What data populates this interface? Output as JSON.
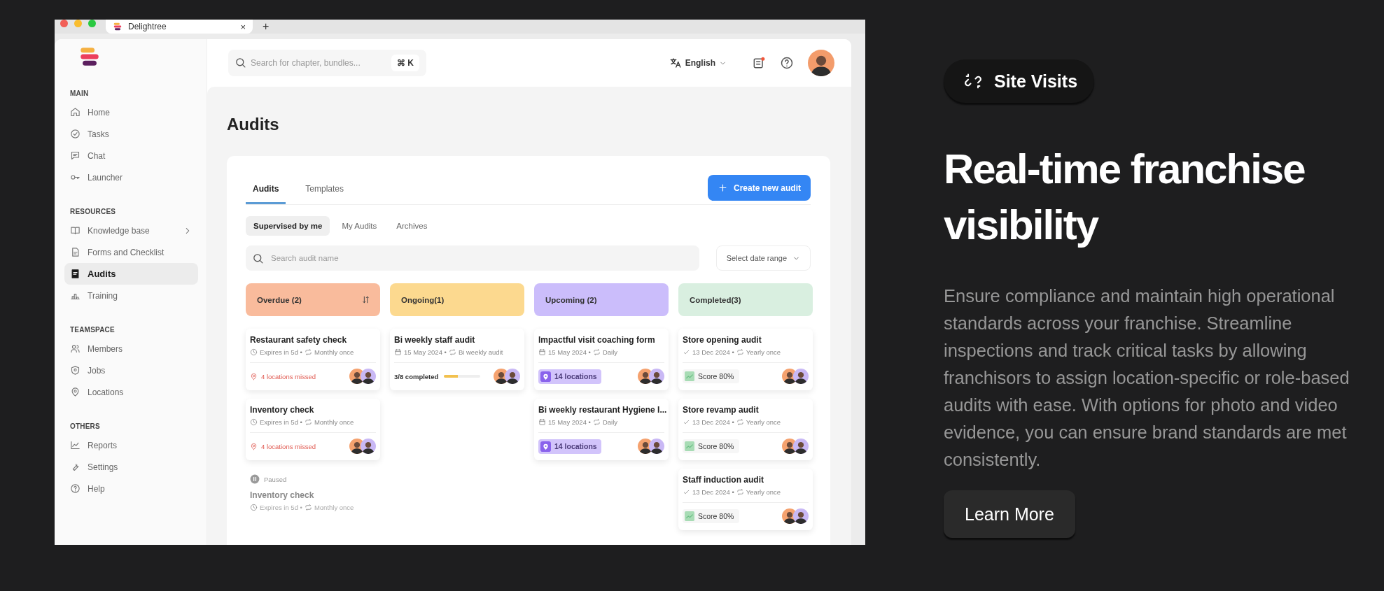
{
  "browser": {
    "tab_title": "Delightree",
    "close": "×",
    "new_tab": "+"
  },
  "app": {
    "sidebar": {
      "sections": [
        {
          "title": "MAIN",
          "items": [
            {
              "label": "Home",
              "selected": false,
              "expandable": false
            },
            {
              "label": "Tasks",
              "selected": false,
              "expandable": false
            },
            {
              "label": "Chat",
              "selected": false,
              "expandable": false
            },
            {
              "label": "Launcher",
              "selected": false,
              "expandable": false
            }
          ]
        },
        {
          "title": "RESOURCES",
          "items": [
            {
              "label": "Knowledge base",
              "selected": false,
              "expandable": true
            },
            {
              "label": "Forms and Checklist",
              "selected": false,
              "expandable": false
            },
            {
              "label": "Audits",
              "selected": true,
              "expandable": false
            },
            {
              "label": "Training",
              "selected": false,
              "expandable": false
            }
          ]
        },
        {
          "title": "TEAMSPACE",
          "items": [
            {
              "label": "Members",
              "selected": false,
              "expandable": false
            },
            {
              "label": "Jobs",
              "selected": false,
              "expandable": false
            },
            {
              "label": "Locations",
              "selected": false,
              "expandable": false
            }
          ]
        },
        {
          "title": "OTHERS",
          "items": [
            {
              "label": "Reports",
              "selected": false,
              "expandable": false
            },
            {
              "label": "Settings",
              "selected": false,
              "expandable": false
            },
            {
              "label": "Help",
              "selected": false,
              "expandable": false
            }
          ]
        }
      ]
    },
    "header": {
      "search_placeholder": "Search for chapter, bundles...",
      "shortcut": "⌘ K",
      "language": "English",
      "unread": true
    },
    "page_title": "Audits",
    "tabs": [
      {
        "label": "Audits",
        "selected": true
      },
      {
        "label": "Templates",
        "selected": false
      }
    ],
    "create_button": "Create new audit",
    "filters": [
      {
        "label": "Supervised by me",
        "selected": true
      },
      {
        "label": "My Audits",
        "selected": false
      },
      {
        "label": "Archives",
        "selected": false
      }
    ],
    "search": {
      "placeholder": "Search audit name"
    },
    "date_range": "Select date range",
    "columns": [
      {
        "title": "Overdue (2)",
        "color": "#f9bb9c",
        "sortable": true,
        "cards": [
          {
            "title": "Restaurant safety check",
            "paused": false,
            "meta": {
              "kind": "expires",
              "text": "Expires in 5d •"
            },
            "repeat": "Monthly once",
            "footer": {
              "kind": "missed",
              "text": "4 locations missed"
            }
          },
          {
            "title": "Inventory check",
            "paused": false,
            "meta": {
              "kind": "expires",
              "text": "Expires in 5d •"
            },
            "repeat": "Monthly once",
            "footer": {
              "kind": "missed",
              "text": "4 locations missed"
            }
          },
          {
            "title": "Inventory check",
            "paused": true,
            "paused_label": "Paused",
            "meta": {
              "kind": "expires",
              "text": "Expires in 5d •"
            },
            "repeat": "Monthly once"
          }
        ]
      },
      {
        "title": "Ongoing(1)",
        "color": "#fcd98f",
        "sortable": false,
        "cards": [
          {
            "title": "Bi weekly staff audit",
            "paused": false,
            "meta": {
              "kind": "date",
              "text": "15 May 2024 •"
            },
            "repeat": "Bi weekly audit",
            "footer": {
              "kind": "progress",
              "text": "3/8 completed",
              "level": 0.375
            }
          }
        ]
      },
      {
        "title": "Upcoming (2)",
        "color": "#cbbdfb",
        "sortable": false,
        "cards": [
          {
            "title": "Impactful visit coaching form",
            "paused": false,
            "meta": {
              "kind": "date",
              "text": "15 May 2024 •"
            },
            "repeat": "Daily",
            "footer": {
              "kind": "locations",
              "text": "14 locations"
            }
          },
          {
            "title": "Bi weekly restaurant Hygiene I...",
            "paused": false,
            "meta": {
              "kind": "date",
              "text": "15 May 2024 •"
            },
            "repeat": "Daily",
            "footer": {
              "kind": "locations",
              "text": "14 locations"
            }
          }
        ]
      },
      {
        "title": "Completed(3)",
        "color": "#d9efe0",
        "sortable": false,
        "cards": [
          {
            "title": "Store opening audit",
            "paused": false,
            "meta": {
              "kind": "done",
              "text": "13 Dec 2024 •"
            },
            "repeat": "Yearly once",
            "footer": {
              "kind": "score",
              "text": "Score 80%"
            }
          },
          {
            "title": "Store revamp audit",
            "paused": false,
            "meta": {
              "kind": "done",
              "text": "13 Dec 2024 •"
            },
            "repeat": "Yearly once",
            "footer": {
              "kind": "score",
              "text": "Score 80%"
            }
          },
          {
            "title": "Staff induction audit",
            "paused": false,
            "meta": {
              "kind": "done",
              "text": "13 Dec 2024 •"
            },
            "repeat": "Yearly once",
            "footer": {
              "kind": "score",
              "text": "Score 80%"
            }
          }
        ]
      }
    ]
  },
  "promo": {
    "badge": "Site Visits",
    "heading": "Real-time franchise visibility",
    "body": "Ensure compliance and maintain high operational standards across your franchise. Streamline inspections and track critical tasks by allowing franchisors to assign location-specific or role-based audits with ease. With options for photo and video evidence, you can ensure brand standards are met consistently.",
    "button": "Learn More"
  }
}
